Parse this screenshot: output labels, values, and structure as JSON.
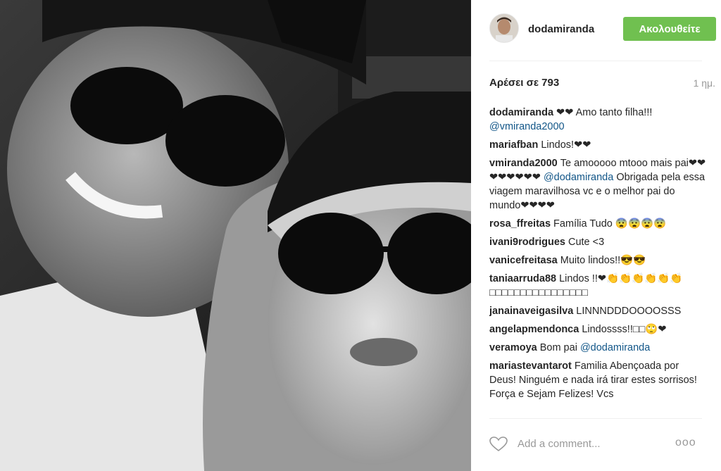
{
  "header": {
    "username": "dodamiranda",
    "follow_label": "Ακολουθείτε"
  },
  "stats": {
    "likes": "Αρέσει σε 793",
    "time": "1 ημ."
  },
  "comments": [
    {
      "user": "dodamiranda",
      "text": "❤❤ Amo tanto filha!!!",
      "mention": "@vmiranda2000",
      "after": ""
    },
    {
      "user": "mariafban",
      "text": "Lindos!❤❤",
      "mention": "",
      "after": ""
    },
    {
      "user": "vmiranda2000",
      "text": "Te amooooo mtooo mais pai❤❤❤❤❤❤❤❤",
      "mention": "@dodamiranda",
      "after": "Obrigada pela essa viagem maravilhosa vc e o melhor pai do mundo❤❤❤❤"
    },
    {
      "user": "rosa_ffreitas",
      "text": "Família Tudo 😨😨😨😨",
      "mention": "",
      "after": ""
    },
    {
      "user": "ivani9rodrigues",
      "text": "Cute <3",
      "mention": "",
      "after": ""
    },
    {
      "user": "vanicefreitasa",
      "text": "Muito lindos!!😎😎",
      "mention": "",
      "after": ""
    },
    {
      "user": "taniaarruda88",
      "text": "Lindos !!❤👏👏👏👏👏👏 □□□□□□□□□□□□□□□□",
      "mention": "",
      "after": ""
    },
    {
      "user": "janainaveigasilva",
      "text": "LINNNDDDOOOOSSS",
      "mention": "",
      "after": ""
    },
    {
      "user": "angelapmendonca",
      "text": "Lindossss!!□□🙄❤",
      "mention": "",
      "after": ""
    },
    {
      "user": "veramoya",
      "text": "Bom pai",
      "mention": "@dodamiranda",
      "after": ""
    },
    {
      "user": "mariastevantarot",
      "text": "Familia Abençoada por Deus! Ninguém e nada irá tirar estes sorrisos! Força e Sejam Felizes! Vcs",
      "mention": "",
      "after": ""
    }
  ],
  "footer": {
    "comment_placeholder": "Add a comment...",
    "more_label": "ooo"
  },
  "colors": {
    "follow_green": "#70c050",
    "mention_blue": "#125688"
  }
}
